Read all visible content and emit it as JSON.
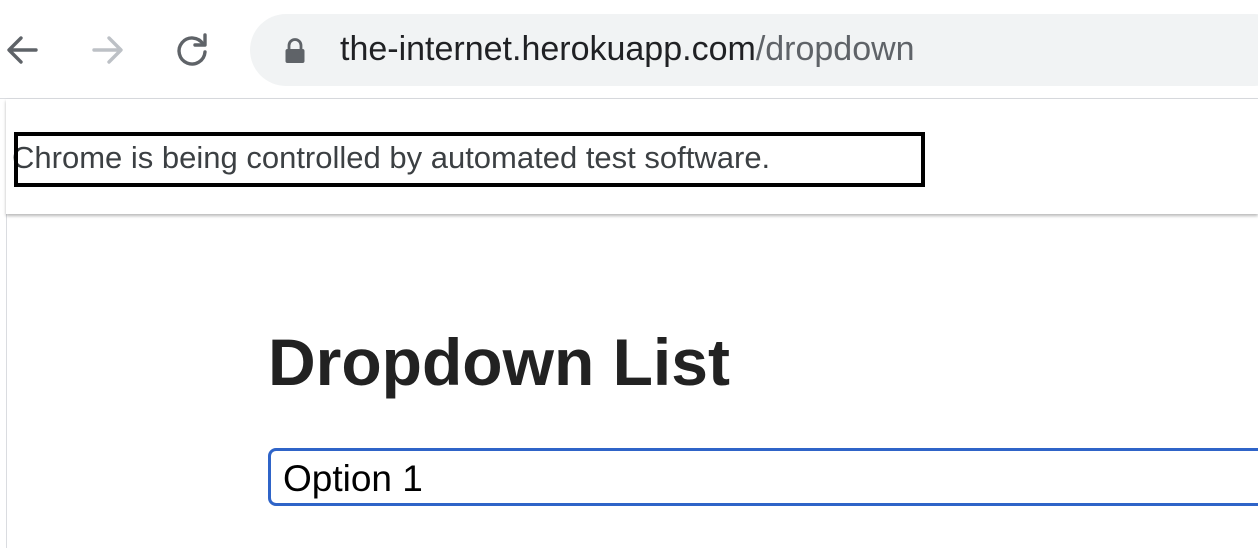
{
  "browser": {
    "nav": {
      "back_icon": "arrow-left-icon",
      "forward_icon": "arrow-right-icon",
      "reload_icon": "reload-icon"
    },
    "address_bar": {
      "lock_icon": "lock-icon",
      "host": "the-internet.herokuapp.com",
      "path": "/dropdown"
    },
    "infobar": {
      "message": "Chrome is being controlled by automated test software."
    }
  },
  "page": {
    "title": "Dropdown List",
    "dropdown": {
      "selected": "Option 1"
    }
  },
  "colors": {
    "dropdown_focus_border": "#2f64c8",
    "omnibox_background": "#f1f3f4",
    "title_text": "#222222"
  }
}
